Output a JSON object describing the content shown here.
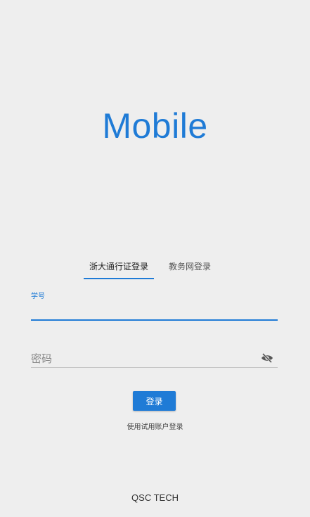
{
  "app": {
    "title": "Mobile"
  },
  "tabs": [
    {
      "label": "浙大通行证登录",
      "active": true
    },
    {
      "label": "教务网登录",
      "active": false
    }
  ],
  "form": {
    "student_id": {
      "label": "学号",
      "value": ""
    },
    "password": {
      "placeholder": "密码",
      "value": "",
      "toggle_icon": "eye-off-icon"
    },
    "login_button": "登录",
    "trial_link": "使用试用账户登录"
  },
  "footer": {
    "text": "QSC TECH"
  },
  "colors": {
    "accent": "#1f7bd6",
    "background": "#eeeeee"
  }
}
